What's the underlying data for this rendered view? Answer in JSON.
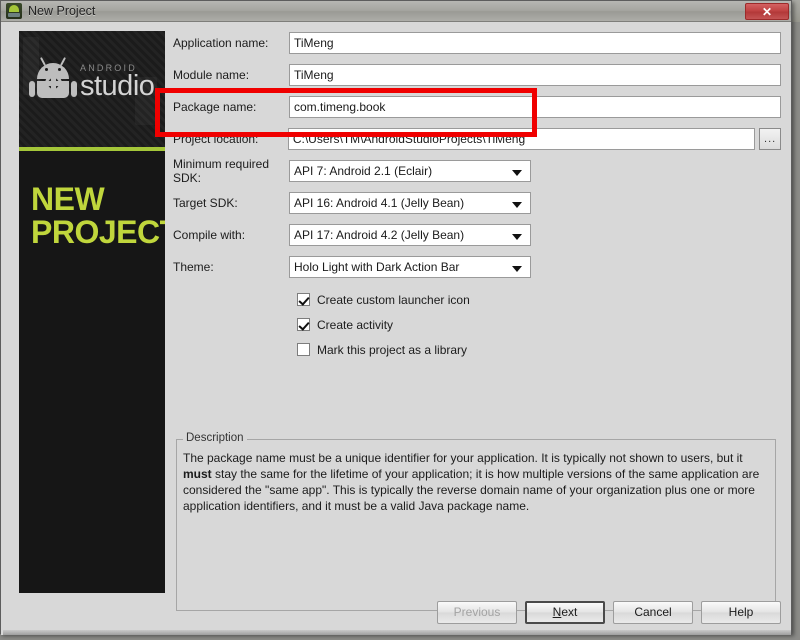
{
  "window": {
    "title": "New Project",
    "icon": "android-studio-icon",
    "close_label": "✕"
  },
  "banner": {
    "logo_brand": "ANDROID",
    "logo_product": "studio",
    "heading_line1": "NEW",
    "heading_line2": "PROJECT",
    "accent_color": "#a4c639",
    "heading_color": "#c0d63c"
  },
  "form": {
    "fields": [
      {
        "label": "Application name:",
        "value": "TiMeng",
        "type": "text"
      },
      {
        "label": "Module name:",
        "value": "TiMeng",
        "type": "text"
      },
      {
        "label": "Package name:",
        "value": "com.timeng.book",
        "type": "text"
      },
      {
        "label": "Project location:",
        "value": "C:\\Users\\TM\\AndroidStudioProjects\\TiMeng",
        "type": "text-browse",
        "browse_label": "..."
      },
      {
        "label": "Minimum required SDK:",
        "value": "API 7: Android 2.1 (Eclair)",
        "type": "combo"
      },
      {
        "label": "Target SDK:",
        "value": "API 16: Android 4.1 (Jelly Bean)",
        "type": "combo"
      },
      {
        "label": "Compile with:",
        "value": "API 17: Android 4.2 (Jelly Bean)",
        "type": "combo"
      },
      {
        "label": "Theme:",
        "value": "Holo Light with Dark Action Bar",
        "type": "combo"
      }
    ],
    "checkboxes": [
      {
        "label": "Create custom launcher icon",
        "checked": true
      },
      {
        "label": "Create activity",
        "checked": true
      },
      {
        "label": "Mark this project as a library",
        "checked": false
      }
    ]
  },
  "description": {
    "title": "Description",
    "text_part1": "The package name must be a unique identifier for your application. It is typically not shown to users, but it ",
    "bold_word": "must",
    "text_part2": " stay the same for the lifetime of your application; it is how multiple versions of the same application are considered the \"same app\". This is typically the reverse domain name of your organization plus one or more application identifiers, and it must be a valid Java package name."
  },
  "footer": {
    "previous_label": "Previous",
    "next_label": "Next",
    "next_mnemonic": "N",
    "next_rest": "ext",
    "cancel_label": "Cancel",
    "help_label": "Help"
  },
  "annotation": {
    "color": "#f00000",
    "description": "red highlight rectangle around package name and project location rows"
  }
}
